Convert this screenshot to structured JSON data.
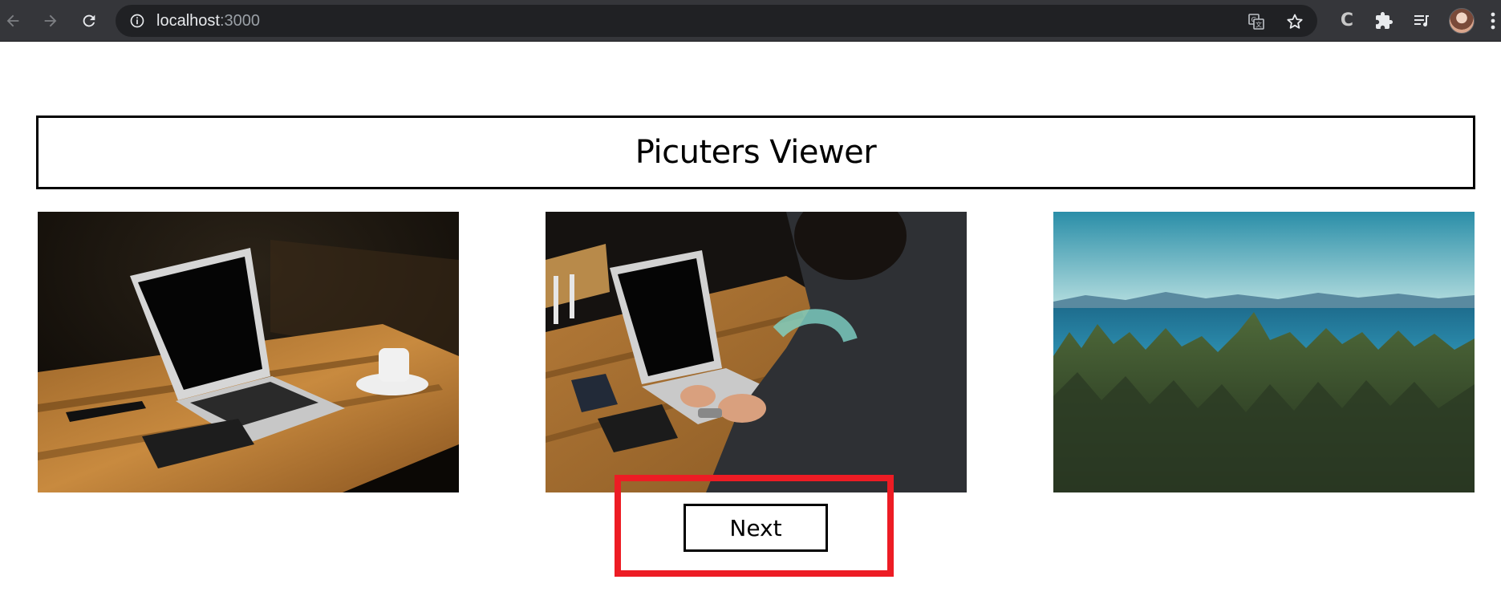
{
  "browser": {
    "url_host": "localhost",
    "url_port": ":3000",
    "icons": {
      "back": "arrow-left-icon",
      "forward": "arrow-right-icon",
      "reload": "reload-icon",
      "site_info": "info-icon",
      "translate": "translate-icon",
      "bookmark": "star-icon",
      "extension_c": "c-extension-icon",
      "extensions": "puzzle-icon",
      "media": "playlist-icon",
      "profile": "avatar",
      "menu": "vertical-dots-icon"
    },
    "extension_c_label": "C"
  },
  "page": {
    "title": "Picuters Viewer",
    "next_label": "Next",
    "photos": [
      {
        "subject": "laptop-on-wooden-table"
      },
      {
        "subject": "man-typing-on-laptop"
      },
      {
        "subject": "forest-and-sea-landscape"
      }
    ],
    "highlight_color": "#ed1c24"
  }
}
